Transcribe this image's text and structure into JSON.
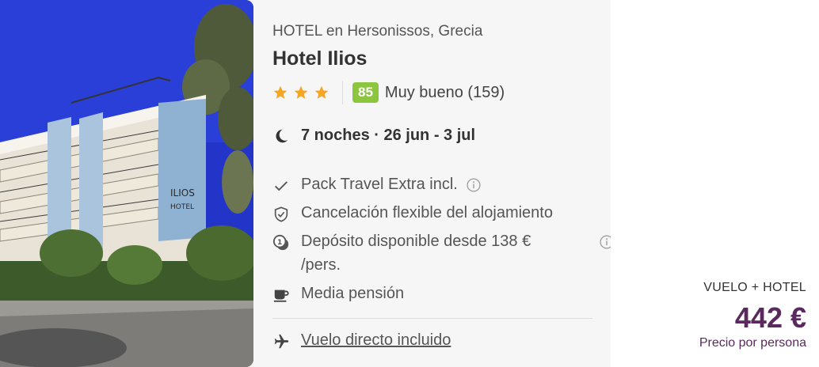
{
  "hotel": {
    "location": "HOTEL en Hersonissos, Grecia",
    "name": "Hotel Ilios",
    "stars": 3,
    "score": "85",
    "score_text": "Muy bueno (159)",
    "sign_text_1": "ILIOS",
    "sign_text_2": "HOTEL"
  },
  "stay": {
    "dates": "7 noches · 26 jun - 3 jul"
  },
  "features": {
    "pack": "Pack Travel Extra incl.",
    "cancel": "Cancelación flexible del alojamiento",
    "deposit_line1": "Depósito disponible desde 138 €",
    "deposit_line2": "/pers.",
    "board": "Media pensión",
    "flight": "Vuelo directo incluido"
  },
  "price": {
    "label": "VUELO + HOTEL",
    "amount": "442 €",
    "per_person": "Precio por persona"
  },
  "colors": {
    "star": "#f5a623",
    "score_badge": "#8cc63f",
    "price": "#5a2a5e"
  },
  "icons": [
    "star-icon",
    "moon-icon",
    "check-icon",
    "shield-check-icon",
    "deposit-icon",
    "info-icon",
    "mug-icon",
    "plane-icon"
  ]
}
